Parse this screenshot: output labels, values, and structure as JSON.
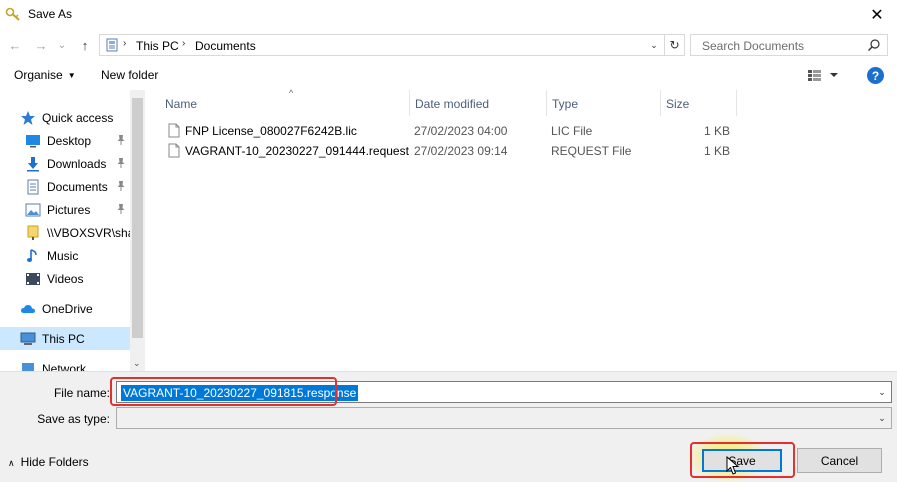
{
  "window": {
    "title": "Save As",
    "close_glyph": "✕"
  },
  "nav": {
    "back_glyph": "←",
    "forward_glyph": "→",
    "recent_glyph": "⌄",
    "up_glyph": "↑",
    "breadcrumb": [
      "This PC",
      "Documents"
    ],
    "breadcrumb_separator": "›",
    "dropdown_glyph": "⌄",
    "refresh_glyph": "↻",
    "search_placeholder": "Search Documents"
  },
  "toolbar": {
    "organise_label": "Organise",
    "organise_caret": "▼",
    "new_folder_label": "New folder",
    "help_glyph": "?"
  },
  "sidebar": {
    "items": [
      {
        "label": "Quick access",
        "icon": "star-icon",
        "pinned": false
      },
      {
        "label": "Desktop",
        "icon": "desktop-icon",
        "pinned": true
      },
      {
        "label": "Downloads",
        "icon": "download-icon",
        "pinned": true
      },
      {
        "label": "Documents",
        "icon": "documents-icon",
        "pinned": true
      },
      {
        "label": "Pictures",
        "icon": "pictures-icon",
        "pinned": true
      },
      {
        "label": "\\\\VBOXSVR\\shar",
        "icon": "network-drive-icon",
        "pinned": false
      },
      {
        "label": "Music",
        "icon": "music-icon",
        "pinned": false
      },
      {
        "label": "Videos",
        "icon": "videos-icon",
        "pinned": false
      },
      {
        "label": "OneDrive",
        "icon": "cloud-icon",
        "pinned": false
      },
      {
        "label": "This PC",
        "icon": "computer-icon",
        "pinned": false,
        "selected": true
      },
      {
        "label": "Network",
        "icon": "network-icon",
        "pinned": false
      }
    ]
  },
  "files": {
    "columns": [
      "Name",
      "Date modified",
      "Type",
      "Size"
    ],
    "sort_glyph": "^",
    "rows": [
      {
        "name": "FNP License_080027F6242B.lic",
        "date": "27/02/2023 04:00",
        "type": "LIC File",
        "size": "1 KB"
      },
      {
        "name": "VAGRANT-10_20230227_091444.request",
        "date": "27/02/2023 09:14",
        "type": "REQUEST File",
        "size": "1 KB"
      }
    ]
  },
  "form": {
    "file_name_label": "File name:",
    "file_name_value": "VAGRANT-10_20230227_091815.response",
    "save_as_type_label": "Save as type:",
    "save_as_type_value": "",
    "dropdown_glyph": "⌄"
  },
  "footer": {
    "hide_folders_label": "Hide Folders",
    "hide_caret": "∧",
    "save_label": "Save",
    "cancel_label": "Cancel"
  },
  "colors": {
    "accent": "#0078d7",
    "highlight": "#e0312f",
    "selection": "#cce8ff"
  }
}
